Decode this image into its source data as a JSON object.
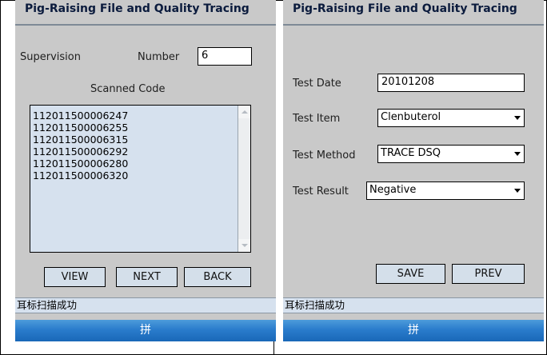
{
  "left": {
    "title": "Pig-Raising File and Quality Tracing",
    "supervision_label": "Supervision",
    "number_label": "Number",
    "number_value": "6",
    "scanned_code_label": "Scanned Code",
    "codes": [
      "112011500006247",
      "112011500006255",
      "112011500006315",
      "112011500006292",
      "112011500006280",
      "112011500006320"
    ],
    "buttons": {
      "view": "VIEW",
      "next": "NEXT",
      "back": "BACK"
    },
    "status": "耳标扫描成功",
    "taskbar": "拼"
  },
  "right": {
    "title": "Pig-Raising File and Quality Tracing",
    "test_date_label": "Test Date",
    "test_date_value": "20101208",
    "test_item_label": "Test Item",
    "test_item_value": "Clenbuterol",
    "test_method_label": "Test Method",
    "test_method_value": "TRACE DSQ",
    "test_result_label": "Test Result",
    "test_result_value": "Negative",
    "buttons": {
      "save": "SAVE",
      "prev": "PREV"
    },
    "status": "耳标扫描成功",
    "taskbar": "拼"
  },
  "icons": {
    "dropdown": "chevron-down-icon",
    "scroll_up": "scroll-up-icon",
    "scroll_down": "scroll-down-icon"
  }
}
